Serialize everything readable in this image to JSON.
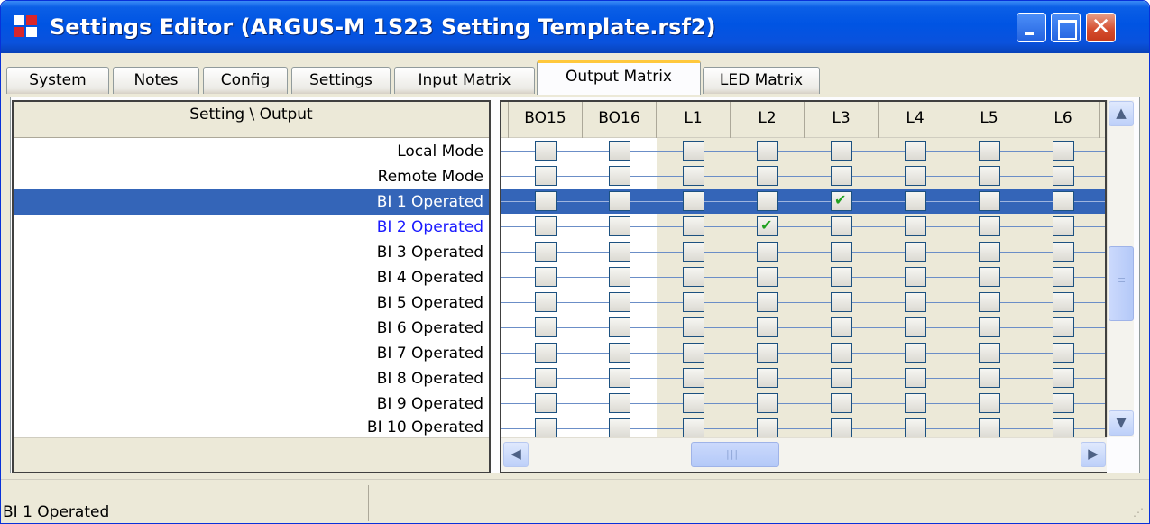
{
  "window": {
    "title": "Settings Editor (ARGUS-M 1S23 Setting Template.rsf2)"
  },
  "tabs": [
    {
      "label": "System"
    },
    {
      "label": "Notes"
    },
    {
      "label": "Config"
    },
    {
      "label": "Settings"
    },
    {
      "label": "Input Matrix"
    },
    {
      "label": "Output Matrix",
      "active": true
    },
    {
      "label": "LED Matrix"
    }
  ],
  "left": {
    "header": "Setting \\ Output",
    "rows": [
      {
        "label": "Local Mode"
      },
      {
        "label": "Remote Mode"
      },
      {
        "label": "BI 1 Operated",
        "selected": true
      },
      {
        "label": "BI 2 Operated",
        "highlight_color": "#1a1aff"
      },
      {
        "label": "BI 3 Operated"
      },
      {
        "label": "BI 4 Operated"
      },
      {
        "label": "BI 5 Operated"
      },
      {
        "label": "BI 6 Operated"
      },
      {
        "label": "BI 7 Operated"
      },
      {
        "label": "BI 8 Operated"
      },
      {
        "label": "BI 9 Operated"
      },
      {
        "label": "BI 10 Operated"
      }
    ]
  },
  "grid": {
    "columns": [
      "BO15",
      "BO16",
      "L1",
      "L2",
      "L3",
      "L4",
      "L5",
      "L6"
    ],
    "checked": [
      {
        "row": "BI 1 Operated",
        "column": "L3"
      },
      {
        "row": "BI 2 Operated",
        "column": "L2"
      }
    ],
    "colors": {
      "selection": "#3465b8",
      "check": "#21a121",
      "led_column_bg": "#ece9d8"
    }
  },
  "status": {
    "text": "BI 1 Operated"
  }
}
